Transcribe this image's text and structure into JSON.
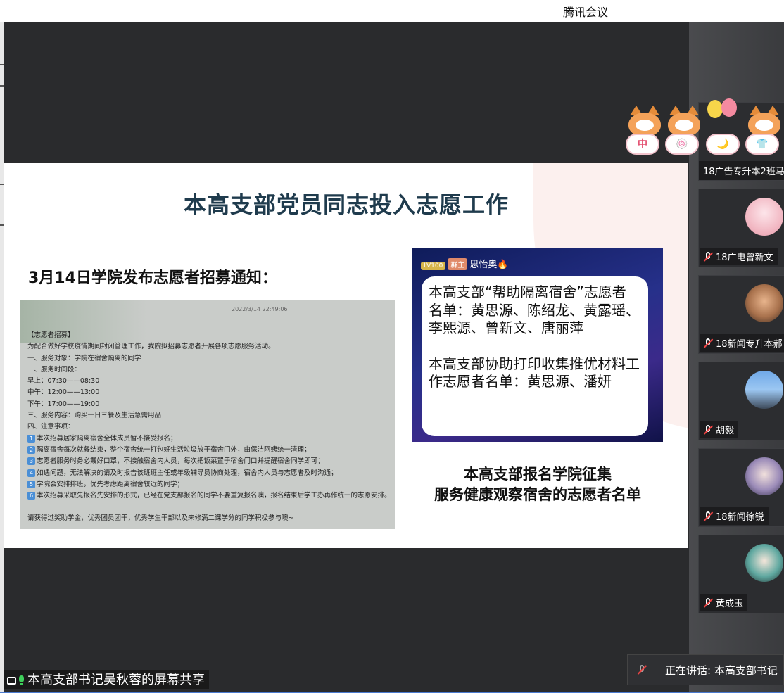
{
  "window": {
    "title": "腾讯会议"
  },
  "slide": {
    "title": "本高支部党员同志投入志愿工作",
    "subtitle": "3月14日学院发布志愿者招募通知：",
    "notice": {
      "timestamp": "2022/3/14 22:49:06",
      "lines": [
        "【志愿者招募】",
        "为配合做好学校疫情期间封闭管理工作，我院拟招募志愿者开展各项志愿服务活动。",
        "一、服务对象：学院在宿舍隔离的同学",
        "二、服务时间段：",
        "早上：07:30——08:30",
        "中午：12:00——13:00",
        "下午：17:00——19:00",
        "三、服务内容：购买一日三餐及生活急需用品",
        "四、注意事项："
      ],
      "items": [
        {
          "num": "1",
          "text": "本次招募居家隔离宿舍全体成员暂不接受报名；"
        },
        {
          "num": "2",
          "text": "隔离宿舍每次就餐结束，整个宿舍统一打包好生活垃圾放于宿舍门外，由保洁阿姨统一清理；"
        },
        {
          "num": "3",
          "text": "志愿者服务时务必戴好口罩，不接触宿舍内人员，每次把饭菜置于宿舍门口并提醒宿舍同学即可；"
        },
        {
          "num": "4",
          "text": "如遇问题，无法解决的请及时报告该班班主任或年级辅导员协商处理，宿舍内人员与志愿者及时沟通；"
        },
        {
          "num": "5",
          "text": "学院会安排排班，优先考虑距离宿舍较近的同学；"
        },
        {
          "num": "6",
          "text": "本次招募采取先报名先安排的形式，已经在党支部报名的同学不要重复报名噢，报名结束后学工办再作统一的志愿安排。"
        }
      ],
      "footer": "请获得过奖助学金，优秀团员团干，优秀学生干部以及未修满二课学分的同学积极参与噢~"
    },
    "chat": {
      "level_badge": "LV100",
      "fan_badge": "群主",
      "sender": "思怡奥",
      "flame": "🔥",
      "message_p1": "本高支部“帮助隔离宿舍”志愿者名单：黄思源、陈绍龙、黄露瑶、李熙源、曾新文、唐丽萍",
      "message_p2": "本高支部协助打印收集推优材料工作志愿者名单：黄思源、潘妍"
    },
    "caption_line1": "本高支部报名学院征集",
    "caption_line2": "服务健康观察宿舍的志愿者名单"
  },
  "deco_labels": [
    "中",
    "🍥",
    "🌙",
    "👕"
  ],
  "participants": [
    {
      "name": "18广告专升本2班马"
    },
    {
      "name": "18广电曾新文"
    },
    {
      "name": "18新闻专升本郝"
    },
    {
      "name": "胡毅"
    },
    {
      "name": "18新闻徐锐"
    },
    {
      "name": "黄成玉"
    }
  ],
  "share_label": "本高支部书记吴秋蓉的屏幕共享",
  "speaking": "正在讲话: 本高支部书记",
  "colors": {
    "accent": "#4b7bd0",
    "slide_title": "#1f3b4d",
    "mic_on": "#3ecf5a",
    "muted": "#e44444"
  }
}
